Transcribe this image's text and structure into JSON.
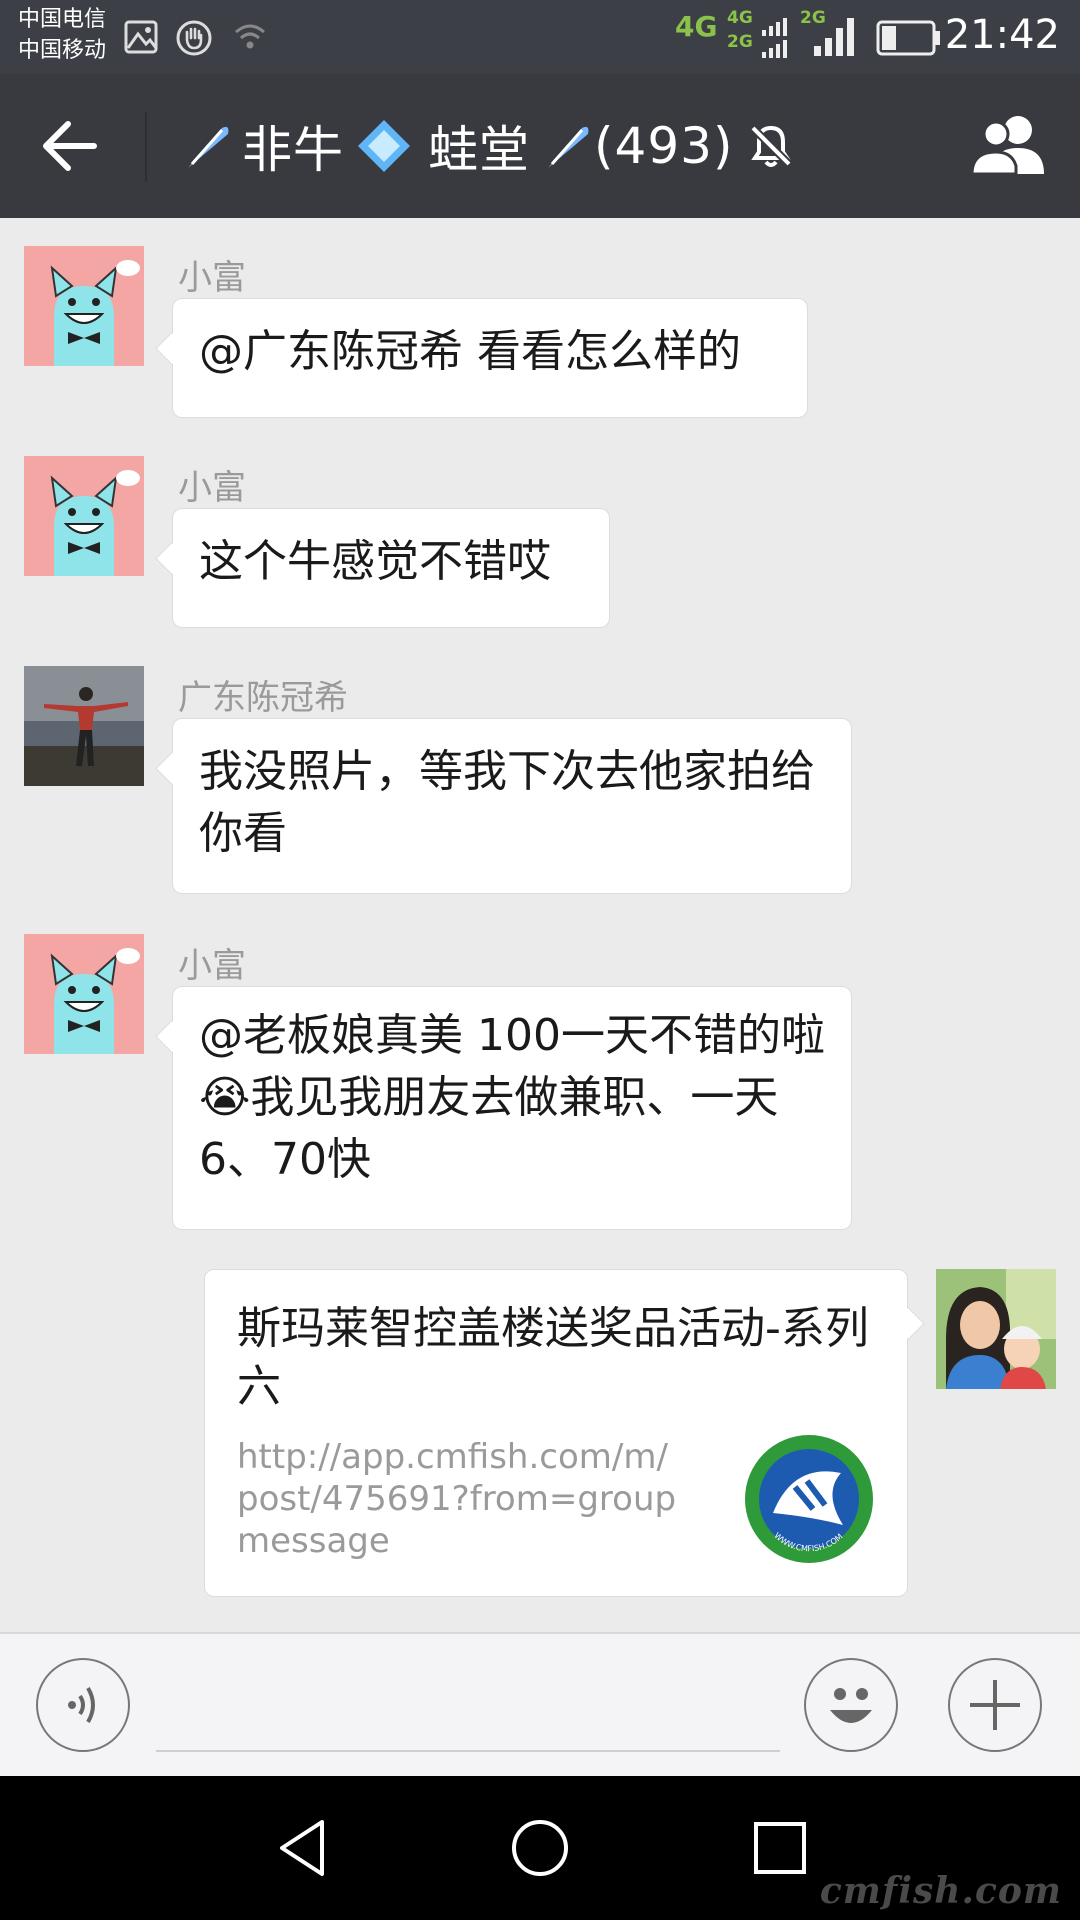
{
  "status_bar": {
    "carrier1": "中国电信",
    "carrier2": "中国移动",
    "network_main": "4G",
    "network_top": "4G",
    "network_bottom": "2G",
    "network_small": "2G",
    "battery_level": 0.3,
    "time": "21:42",
    "icons": [
      "gallery-icon",
      "hand-icon",
      "wifi-icon",
      "signal-icon",
      "battery-icon"
    ]
  },
  "title_bar": {
    "title": "非牛 💠 蛙堂 ☄(493)",
    "title_parts": [
      "非牛",
      "蛙堂",
      "(493)"
    ],
    "icons": [
      "back-arrow-icon",
      "comet-icon",
      "diamond-icon",
      "muted-bell-icon",
      "group-members-icon"
    ]
  },
  "messages": [
    {
      "sender": "小富",
      "text": "@广东陈冠希 看看怎么样的",
      "avatar": "cat-avatar"
    },
    {
      "sender": "小富",
      "text": "这个牛感觉不错哎",
      "avatar": "cat-avatar"
    },
    {
      "sender": "广东陈冠希",
      "text": "我没照片，等我下次去他家拍给你看",
      "avatar": "beach-photo-avatar"
    },
    {
      "sender": "小富",
      "text": "@老板娘真美 100一天不错的啦😭我见我朋友去做兼职、一天6、70快",
      "avatar": "cat-avatar"
    }
  ],
  "link_card": {
    "title": "斯玛莱智控盖楼送奖品活动-系列六",
    "url": "http://app.cmfish.com/m/post/475691?from=groupmessage",
    "thumb": "cmfish-logo",
    "thumb_text": "WWW.CMFISH.COM"
  },
  "input_bar": {
    "icons": [
      "voice-icon",
      "emoji-icon",
      "plus-icon"
    ]
  },
  "nav_bar": {
    "icons": [
      "nav-back-icon",
      "nav-home-icon",
      "nav-recents-icon"
    ]
  },
  "watermark": "cmfish.com",
  "colors": {
    "title_bg": "#393a3f",
    "status_bg": "#3c3f45",
    "chat_bg": "#ebebeb",
    "bubble_bg": "#ffffff",
    "network_green": "#8bc34a"
  }
}
